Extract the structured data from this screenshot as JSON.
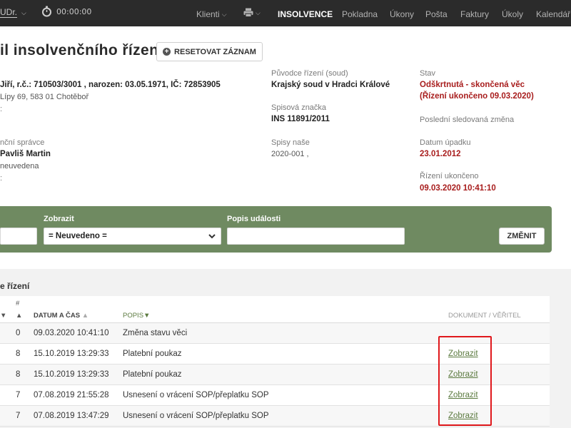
{
  "topbar": {
    "user": "UDr.",
    "timer": "00:00:00",
    "nav": [
      {
        "label": "Klienti",
        "caret": true
      },
      {
        "label": "",
        "caret": true
      },
      {
        "label": "INSOLVENCE",
        "caret": false
      },
      {
        "label": "Pokladna",
        "caret": false
      },
      {
        "label": "Úkony",
        "caret": false
      },
      {
        "label": "Pošta",
        "caret": false
      },
      {
        "label": "Faktury",
        "caret": false
      },
      {
        "label": "Úkoly",
        "caret": false
      },
      {
        "label": "Kalendář",
        "caret": false
      }
    ]
  },
  "header": {
    "title": "il insolvenčního řízení",
    "reset_label": "RESETOVAT ZÁZNAM",
    "debtor_line": "Jiří, r.č.: 710503/3001 , narozen: 03.05.1971, IČ: 72853905",
    "debtor_address": "Lípy 69, 583 01 Chotěboř",
    "debtor_extra": ":",
    "admin_label": "nční správce",
    "admin_name": "Pavliš Martin",
    "admin_extra": "neuvedena",
    "admin_extra2": ":",
    "origin_label": "Původce řízení (soud)",
    "origin_value": "Krajský soud v Hradci Králové",
    "file_label": "Spisová značka",
    "file_value": "INS 11891/2011",
    "our_label": "Spisy naše",
    "our_value": "2020-001 ,",
    "state_label": "Stav",
    "state_value_1": "Odškrtnutá - skončená věc",
    "state_value_2": "(Řízení ukončeno 09.03.2020)",
    "last_change_label": "Poslední sledovaná změna",
    "bankruptcy_label": "Datum úpadku",
    "bankruptcy_value": "23.01.2012",
    "ended_label": "Řízení ukončeno",
    "ended_value": "09.03.2020 10:41:10"
  },
  "filter": {
    "show_label": "Zobrazit",
    "show_value": "= Neuvedeno =",
    "desc_label": "Popis události",
    "desc_value": "",
    "change_label": "ZMĚNIT"
  },
  "events": {
    "title": "e řízení",
    "headers": {
      "sort": "▼",
      "num_top": "#",
      "num_bottom": "▲",
      "datetime": "DATUM A ČAS",
      "datetime_sort": "▲",
      "desc": "POPIS",
      "desc_sort": "▼",
      "doc": "DOKUMENT / VĚŘITEL"
    },
    "rows": [
      {
        "num": "0",
        "datetime": "09.03.2020 10:41:10",
        "desc": "Změna stavu věci",
        "doc": ""
      },
      {
        "num": "8",
        "datetime": "15.10.2019 13:29:33",
        "desc": "Platební poukaz",
        "doc": "Zobrazit"
      },
      {
        "num": "8",
        "datetime": "15.10.2019 13:29:33",
        "desc": "Platební poukaz",
        "doc": "Zobrazit"
      },
      {
        "num": "7",
        "datetime": "07.08.2019 21:55:28",
        "desc": "Usnesení o vrácení SOP/přeplatku SOP",
        "doc": "Zobrazit"
      },
      {
        "num": "7",
        "datetime": "07.08.2019 13:47:29",
        "desc": "Usnesení o vrácení SOP/přeplatku SOP",
        "doc": "Zobrazit"
      }
    ]
  },
  "colors": {
    "topbar": "#2b2b2b",
    "filter_band": "#6f8a61",
    "status_red": "#a81d1d",
    "link_green": "#5b7a3f",
    "highlight": "#e0181c"
  }
}
